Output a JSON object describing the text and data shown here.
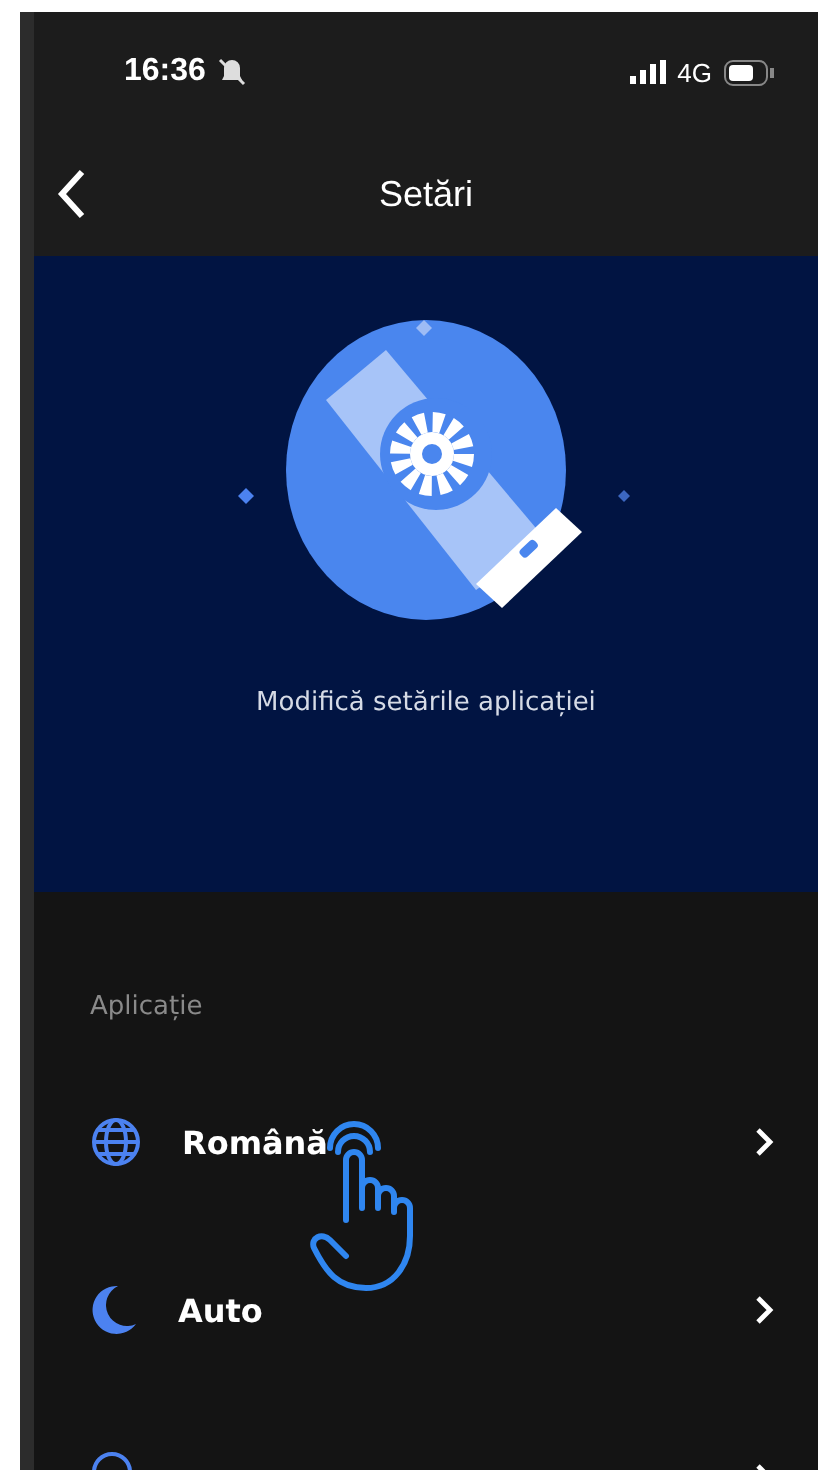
{
  "status_bar": {
    "time": "16:36",
    "network": "4G"
  },
  "nav": {
    "title": "Setări"
  },
  "hero": {
    "caption": "Modifică setările aplicației"
  },
  "section": {
    "title": "Aplicație"
  },
  "items": [
    {
      "kind": "language",
      "label": "Română"
    },
    {
      "kind": "theme",
      "label": "Auto"
    },
    {
      "kind": "location"
    }
  ]
}
